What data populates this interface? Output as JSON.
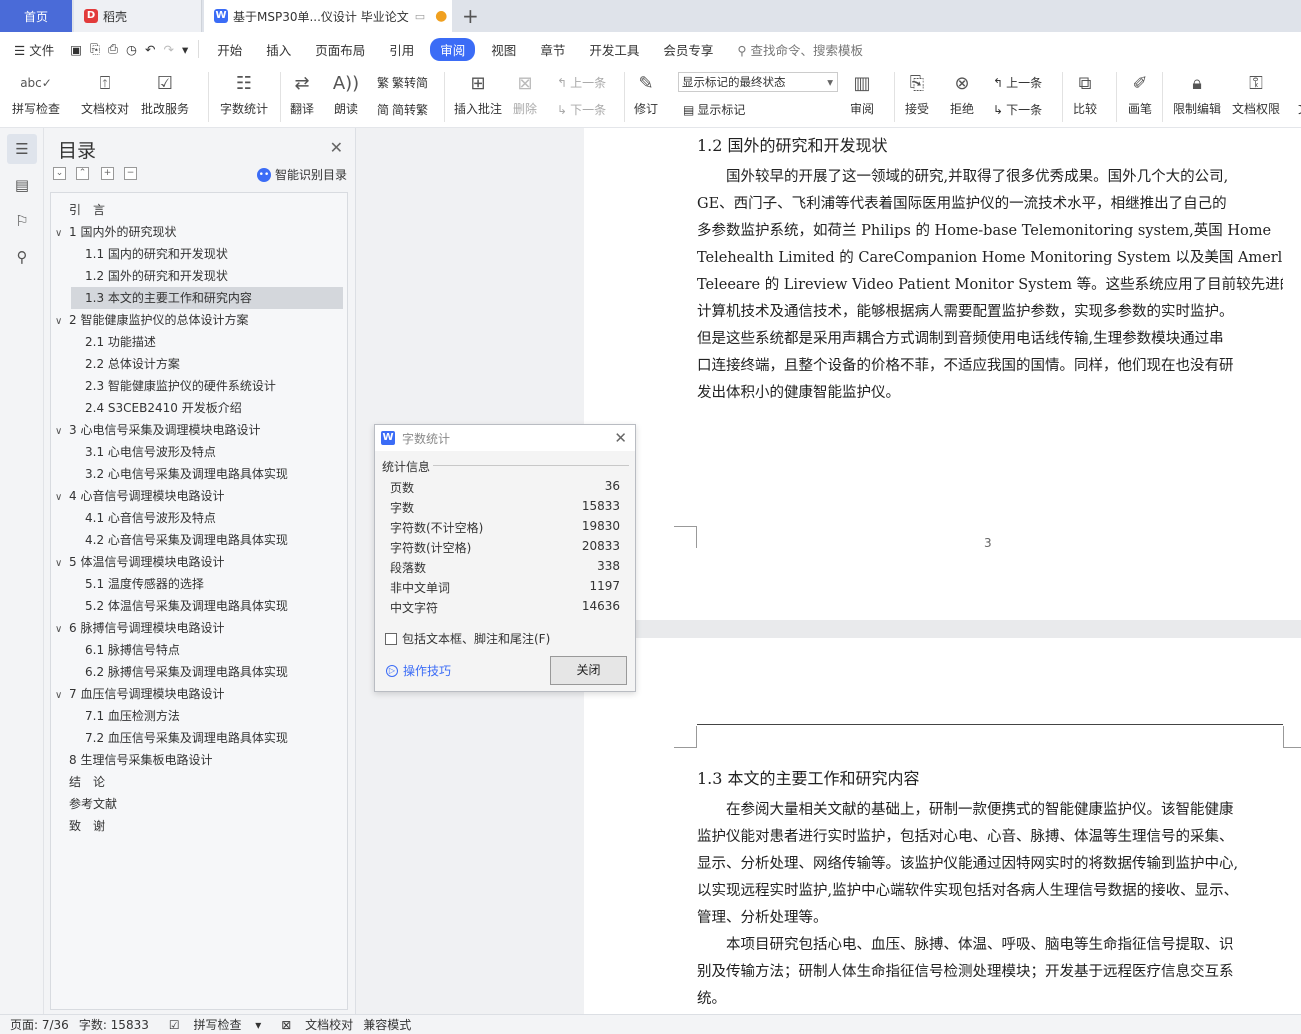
{
  "tabs": {
    "home": "首页",
    "daoke": "稻壳",
    "doc": "基于MSP30单...仪设计 毕业论文",
    "new_tab": "+"
  },
  "menu": {
    "file": "文件",
    "items": [
      "开始",
      "插入",
      "页面布局",
      "引用",
      "审阅",
      "视图",
      "章节",
      "开发工具",
      "会员专享"
    ],
    "active_index": 4,
    "search": "查找命令、搜索模板"
  },
  "ribbon": {
    "spell": "拼写检查",
    "doc_check": "文档校对",
    "batch": "批改服务",
    "word_count": "字数统计",
    "translate": "翻译",
    "read": "朗读",
    "trad": "繁转简",
    "simp": "简转繁",
    "insert_comment": "插入批注",
    "delete": "删除",
    "prev": "上一条",
    "next": "下一条",
    "revise": "修订",
    "markup_state": "显示标记的最终状态",
    "show_markup": "显示标记",
    "review": "审阅",
    "accept": "接受",
    "reject": "拒绝",
    "prev2": "上一条",
    "next2": "下一条",
    "compare": "比较",
    "pen": "画笔",
    "restrict": "限制编辑",
    "doc_perm": "文档权限",
    "cut_label": "文"
  },
  "toc": {
    "title": "目录",
    "smart": "智能识别目录",
    "items": [
      {
        "label": "引　言",
        "level": 0,
        "arrow": ""
      },
      {
        "label": "1  国内外的研究现状",
        "level": 0,
        "arrow": "∨"
      },
      {
        "label": "1.1 国内的研究和开发现状",
        "level": 1,
        "arrow": ""
      },
      {
        "label": "1.2 国外的研究和开发现状",
        "level": 1,
        "arrow": ""
      },
      {
        "label": "1.3 本文的主要工作和研究内容",
        "level": 1,
        "arrow": "",
        "selected": true
      },
      {
        "label": "2 智能健康监护仪的总体设计方案",
        "level": 0,
        "arrow": "∨"
      },
      {
        "label": "2.1 功能描述",
        "level": 1,
        "arrow": ""
      },
      {
        "label": "2.2 总体设计方案",
        "level": 1,
        "arrow": ""
      },
      {
        "label": "2.3 智能健康监护仪的硬件系统设计",
        "level": 1,
        "arrow": ""
      },
      {
        "label": "2.4 S3CEB2410 开发板介绍",
        "level": 1,
        "arrow": ""
      },
      {
        "label": "3 心电信号采集及调理模块电路设计",
        "level": 0,
        "arrow": "∨"
      },
      {
        "label": "3.1 心电信号波形及特点",
        "level": 1,
        "arrow": ""
      },
      {
        "label": "3.2 心电信号采集及调理电路具体实现",
        "level": 1,
        "arrow": ""
      },
      {
        "label": "4 心音信号调理模块电路设计",
        "level": 0,
        "arrow": "∨"
      },
      {
        "label": "4.1 心音信号波形及特点",
        "level": 1,
        "arrow": ""
      },
      {
        "label": "4.2 心音信号采集及调理电路具体实现",
        "level": 1,
        "arrow": ""
      },
      {
        "label": "5 体温信号调理模块电路设计",
        "level": 0,
        "arrow": "∨"
      },
      {
        "label": "5.1 温度传感器的选择",
        "level": 1,
        "arrow": ""
      },
      {
        "label": "5.2 体温信号采集及调理电路具体实现",
        "level": 1,
        "arrow": ""
      },
      {
        "label": "6 脉搏信号调理模块电路设计",
        "level": 0,
        "arrow": "∨"
      },
      {
        "label": "6.1 脉搏信号特点",
        "level": 1,
        "arrow": ""
      },
      {
        "label": "6.2 脉搏信号采集及调理电路具体实现",
        "level": 1,
        "arrow": ""
      },
      {
        "label": "7 血压信号调理模块电路设计",
        "level": 0,
        "arrow": "∨"
      },
      {
        "label": "7.1 血压检测方法",
        "level": 1,
        "arrow": ""
      },
      {
        "label": "7.2 血压信号采集及调理电路具体实现",
        "level": 1,
        "arrow": ""
      },
      {
        "label": "8 生理信号采集板电路设计",
        "level": 0,
        "arrow": ""
      },
      {
        "label": "结　论",
        "level": 0,
        "arrow": ""
      },
      {
        "label": "参考文献",
        "level": 0,
        "arrow": ""
      },
      {
        "label": "致　谢",
        "level": 0,
        "arrow": ""
      }
    ]
  },
  "document": {
    "heading1": "1.2 国外的研究和开发现状",
    "para1": [
      "　　国外较早的开展了这一领域的研究,并取得了很多优秀成果。国外几个大的公司,",
      "GE、西门子、飞利浦等代表着国际医用监护仪的一流技术水平，相继推出了自己的",
      "多参数监护系统，如荷兰 Philips 的 Home-base Telemonitoring system,英国  Home",
      "Telehealth Limited 的 CareCompanion Home Monitoring System 以及美国 Amerlean",
      "Teleeare 的 Lireview Video Patient Monitor    System 等。这些系统应用了目前较先进的",
      "计算机技术及通信技术，能够根据病人需要配置监护参数，实现多参数的实时监护。",
      "但是这些系统都是采用声耦合方式调制到音频使用电话线传输,生理参数模块通过串",
      "口连接终端，且整个设备的价格不菲，不适应我国的国情。同样，他们现在也没有研",
      "发出体积小的健康智能监护仪。"
    ],
    "page_number": "3",
    "heading2": "1.3 本文的主要工作和研究内容",
    "para2": [
      "　　在参阅大量相关文献的基础上，研制一款便携式的智能健康监护仪。该智能健康",
      "监护仪能对患者进行实时监护，包括对心电、心音、脉搏、体温等生理信号的采集、",
      "显示、分析处理、网络传输等。该监护仪能通过因特网实时的将数据传输到监护中心,",
      "以实现远程实时监护,监护中心端软件实现包括对各病人生理信号数据的接收、显示、",
      "管理、分析处理等。",
      "　　本项目研究包括心电、血压、脉搏、体温、呼吸、脑电等生命指征信号提取、识",
      "别及传输方法；研制人体生命指征信号检测处理模块；开发基于远程医疗信息交互系",
      "统。"
    ]
  },
  "dialog": {
    "title": "字数统计",
    "section": "统计信息",
    "stats": [
      {
        "label": "页数",
        "value": "36"
      },
      {
        "label": "字数",
        "value": "15833"
      },
      {
        "label": "字符数(不计空格)",
        "value": "19830"
      },
      {
        "label": "字符数(计空格)",
        "value": "20833"
      },
      {
        "label": "段落数",
        "value": "338"
      },
      {
        "label": "非中文单词",
        "value": "1197"
      },
      {
        "label": "中文字符",
        "value": "14636"
      }
    ],
    "checkbox": "包括文本框、脚注和尾注(F)",
    "tips": "操作技巧",
    "close": "关闭"
  },
  "status": {
    "page": "页面: 7/36",
    "words": "字数: 15833",
    "spell": "拼写检查",
    "check": "文档校对",
    "mode": "兼容模式"
  },
  "colors": {
    "accent": "#3b6cf6",
    "home_tab": "#4a6bd8"
  }
}
